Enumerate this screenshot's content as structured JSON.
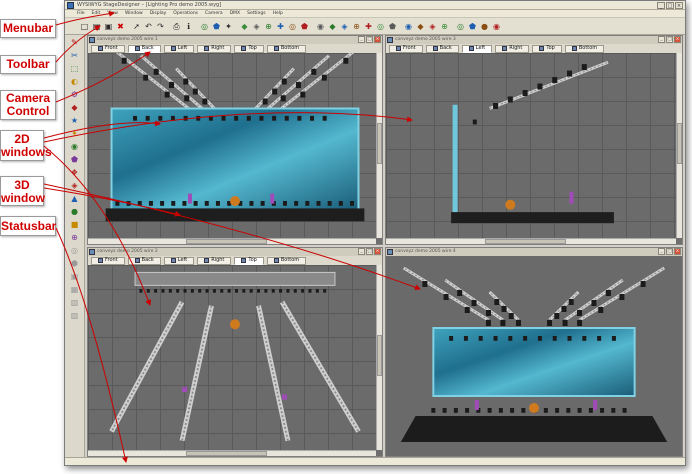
{
  "window": {
    "title": "WYSIWYG StageDesigner – [Lighting Pro demo 2005.wyg]",
    "controls": [
      "_",
      "□",
      "×"
    ]
  },
  "menubar": {
    "items": [
      "File",
      "Edit",
      "View",
      "Window",
      "Display",
      "Operations",
      "Camera",
      "DMX",
      "Settings",
      "Help"
    ]
  },
  "toolbar": {
    "icons": [
      "new-icon",
      "open-icon",
      "save-icon",
      "delete-icon",
      "sep",
      "select-icon",
      "undo-icon",
      "redo-icon",
      "sep",
      "print-icon",
      "info-icon",
      "sep",
      "tool-1-icon",
      "tool-2-icon",
      "light-icon",
      "sep",
      "tool-3-icon",
      "tool-4-icon",
      "tool-5-icon",
      "tool-6-icon",
      "tool-7-icon",
      "tool-8-icon",
      "sep",
      "camera-1-icon",
      "camera-2-icon",
      "camera-3-icon",
      "camera-4-icon",
      "camera-5-icon",
      "camera-6-icon",
      "camera-7-icon",
      "sep",
      "view-1-icon",
      "view-2-icon",
      "view-3-icon",
      "view-4-icon",
      "sep",
      "render-1-icon",
      "render-2-icon",
      "render-3-icon",
      "render-4-icon"
    ]
  },
  "left_tools": {
    "icons": [
      "tool-a-icon",
      "tool-b-icon",
      "tool-c-icon",
      "tool-d-icon",
      "tool-e-icon",
      "tool-f-icon",
      "tool-g-icon",
      "tool-h-icon",
      "tool-i-icon",
      "tool-j-icon",
      "tool-k-icon",
      "tool-l-icon",
      "tool-m-icon",
      "tool-n-icon",
      "tool-o-icon",
      "tool-p-icon",
      "tool-q-icon",
      "tool-r-icon",
      "tool-s-icon",
      "tool-t-icon",
      "tool-u-icon",
      "tool-v-icon"
    ]
  },
  "viewports": [
    {
      "title": "conveyz demo 2005 wire 1",
      "tabs": [
        "Front",
        "Back",
        "Left",
        "Right",
        "Top",
        "Bottom"
      ],
      "active_tab": "Back",
      "kind": "front"
    },
    {
      "title": "conveyz demo 2005 wire 3",
      "tabs": [
        "Front",
        "Back",
        "Left",
        "Right",
        "Top",
        "Bottom"
      ],
      "active_tab": "Left",
      "kind": "side"
    },
    {
      "title": "conveyz demo 2005 wire 2",
      "tabs": [
        "Front",
        "Back",
        "Left",
        "Right",
        "Top",
        "Bottom"
      ],
      "active_tab": "Top",
      "kind": "top"
    },
    {
      "title": "conveyz demo 2005 wire 4",
      "tabs": [],
      "active_tab": "",
      "kind": "3d"
    }
  ],
  "callouts": [
    {
      "label": "Menubar"
    },
    {
      "label": "Toolbar"
    },
    {
      "label": "Camera Control"
    },
    {
      "label": "2D windows"
    },
    {
      "label": "3D window"
    },
    {
      "label": "Statusbar"
    }
  ],
  "colors": {
    "callout_text": "#d00000",
    "arrow": "#cc0000",
    "screen": "#2a8aa6"
  }
}
